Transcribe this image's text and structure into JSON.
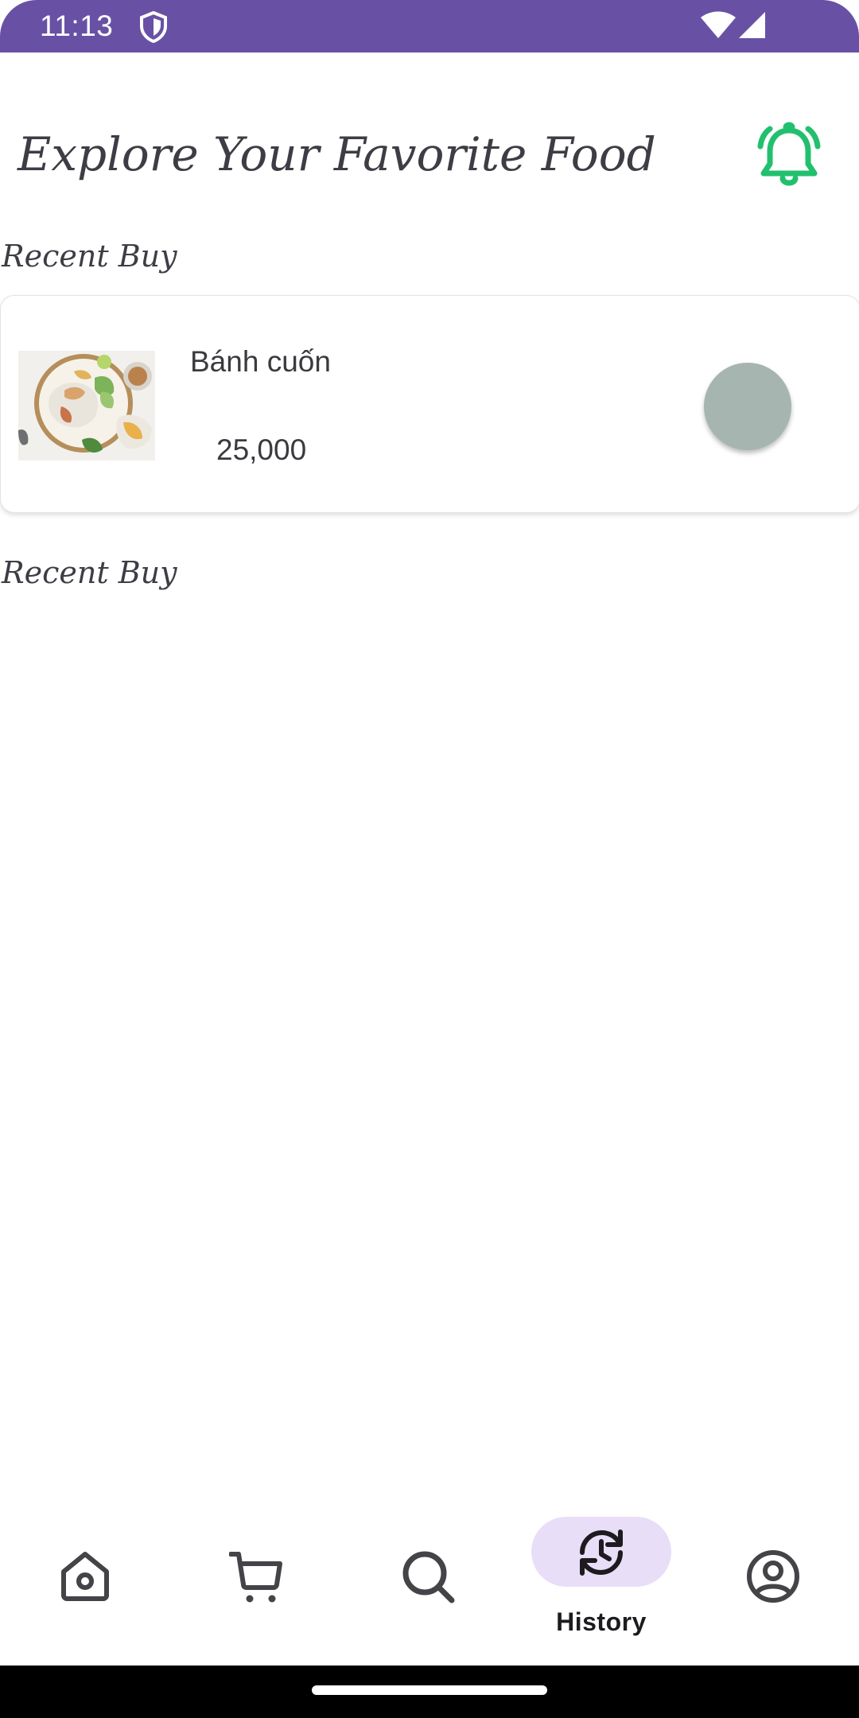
{
  "status_bar": {
    "time": "11:13",
    "icons": [
      "shield-icon",
      "wifi-icon",
      "signal-icon"
    ]
  },
  "header": {
    "title": "Explore Your Favorite Food",
    "bell_icon": "bell-ringing-icon",
    "bell_color": "#22c06e"
  },
  "sections": [
    {
      "label": "Recent Buy"
    },
    {
      "label": "Recent Buy"
    }
  ],
  "recent_items": [
    {
      "name": "Bánh cuốn",
      "price": "25,000",
      "image": "food-photo",
      "action_color": "#a6b5b0"
    }
  ],
  "bottom_nav": {
    "items": [
      {
        "icon": "home-icon"
      },
      {
        "icon": "cart-icon"
      },
      {
        "icon": "search-icon"
      },
      {
        "icon": "history-icon",
        "label": "History",
        "selected": true
      },
      {
        "icon": "account-icon"
      }
    ],
    "selected_color": "#e8def7"
  },
  "colors": {
    "status_bar": "#6851a5",
    "text": "#3a3a3f"
  }
}
